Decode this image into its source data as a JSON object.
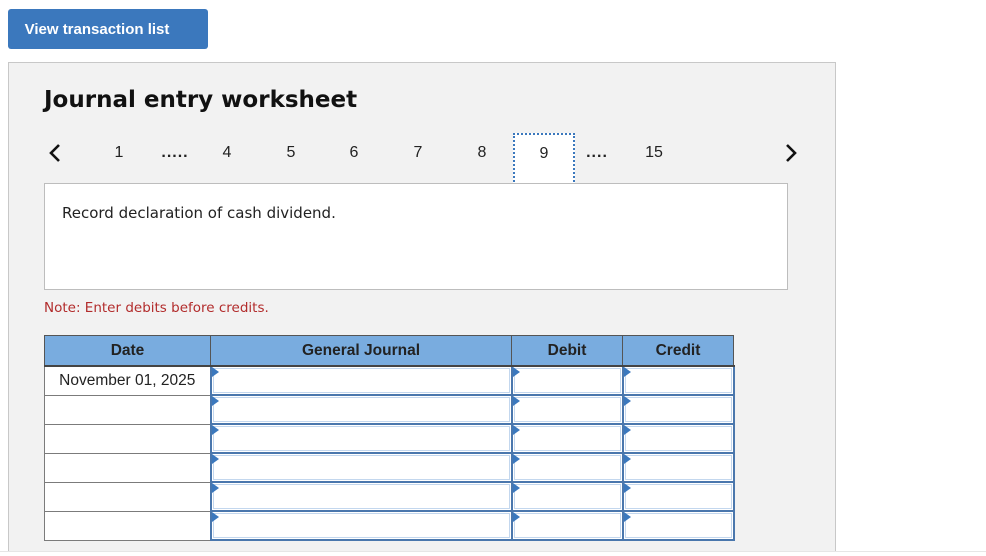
{
  "toolbar": {
    "view_transaction_list_label": "View transaction list"
  },
  "worksheet": {
    "title": "Journal entry worksheet",
    "nav": {
      "prev_icon": "chevron-left-icon",
      "next_icon": "chevron-right-icon",
      "items": [
        "1",
        ".....",
        "4",
        "5",
        "6",
        "7",
        "8",
        "9",
        "....",
        "15"
      ],
      "active": "9"
    },
    "description": "Record declaration of cash dividend.",
    "note": "Note: Enter debits before credits.",
    "table": {
      "headers": {
        "date": "Date",
        "general_journal": "General Journal",
        "debit": "Debit",
        "credit": "Credit"
      },
      "rows": [
        {
          "date": "November 01, 2025",
          "account": "",
          "debit": "",
          "credit": ""
        },
        {
          "date": "",
          "account": "",
          "debit": "",
          "credit": ""
        },
        {
          "date": "",
          "account": "",
          "debit": "",
          "credit": ""
        },
        {
          "date": "",
          "account": "",
          "debit": "",
          "credit": ""
        },
        {
          "date": "",
          "account": "",
          "debit": "",
          "credit": ""
        },
        {
          "date": "",
          "account": "",
          "debit": "",
          "credit": ""
        }
      ]
    }
  },
  "colors": {
    "accent": "#3b78bd",
    "header_bg": "#79acdf",
    "note": "#b22c2c",
    "panel_bg": "#f2f2f2"
  }
}
